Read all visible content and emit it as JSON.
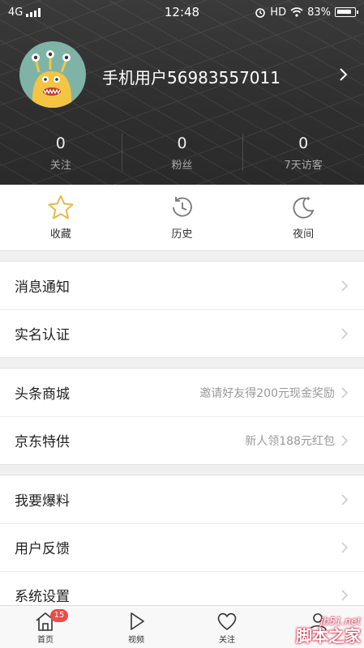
{
  "status_bar": {
    "network": "4G",
    "time": "12:48",
    "hd": "HD",
    "battery": "83%"
  },
  "profile": {
    "username": "手机用户56983557011",
    "stats": [
      {
        "value": "0",
        "label": "关注"
      },
      {
        "value": "0",
        "label": "粉丝"
      },
      {
        "value": "0",
        "label": "7天访客"
      }
    ]
  },
  "quick_actions": [
    {
      "label": "收藏",
      "icon": "star-icon"
    },
    {
      "label": "历史",
      "icon": "history-icon"
    },
    {
      "label": "夜间",
      "icon": "night-mode-icon"
    }
  ],
  "menu": {
    "group1": [
      {
        "title": "消息通知",
        "hint": ""
      },
      {
        "title": "实名认证",
        "hint": ""
      }
    ],
    "group2": [
      {
        "title": "头条商城",
        "hint": "邀请好友得200元现金奖励"
      },
      {
        "title": "京东特供",
        "hint": "新人领188元红包"
      }
    ],
    "group3": [
      {
        "title": "我要爆料",
        "hint": ""
      },
      {
        "title": "用户反馈",
        "hint": ""
      },
      {
        "title": "系统设置",
        "hint": ""
      }
    ]
  },
  "tabbar": {
    "items": [
      {
        "label": "首页",
        "icon": "home-icon",
        "badge": "15"
      },
      {
        "label": "视频",
        "icon": "play-icon"
      },
      {
        "label": "关注",
        "icon": "heart-icon"
      },
      {
        "label": "",
        "icon": "person-icon"
      }
    ]
  },
  "watermark": {
    "line1": "jb51.net",
    "line2": "脚本之家"
  },
  "colors": {
    "header_bg": "#2f2f2f",
    "badge": "#f04b4b",
    "star": "#e8b84a"
  }
}
